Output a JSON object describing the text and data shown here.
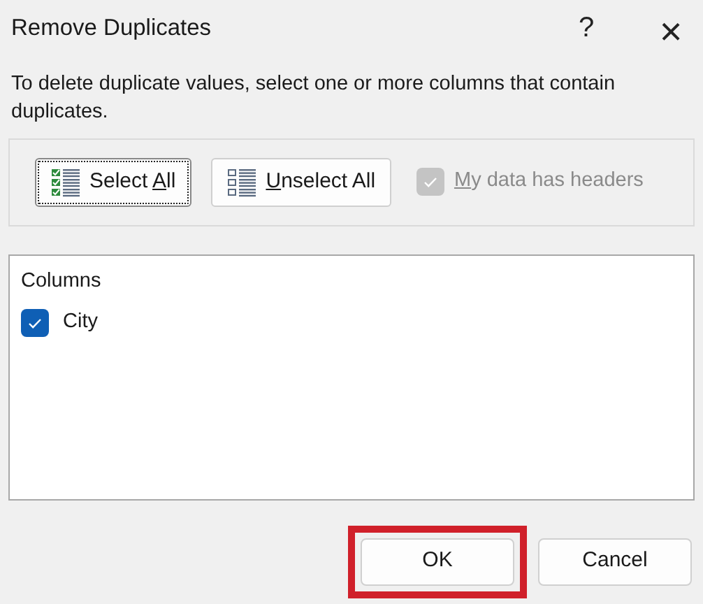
{
  "window": {
    "title": "Remove Duplicates",
    "help": "?",
    "close": "×"
  },
  "description": "To delete duplicate values, select one or more columns that contain duplicates.",
  "toolbar": {
    "buttons": [
      {
        "kind": "select",
        "before": "Select ",
        "key": "A",
        "after": "ll",
        "focused": true
      },
      {
        "kind": "unselect",
        "key": "U",
        "after": "nselect All",
        "focused": false
      }
    ],
    "headers_option": {
      "key": "M",
      "after": "y data has headers",
      "checked": true,
      "disabled": true
    }
  },
  "columns_list": {
    "heading": "Columns",
    "items": [
      {
        "label": "City",
        "checked": true
      }
    ]
  },
  "buttons": [
    {
      "label": "OK",
      "highlighted": true
    },
    {
      "label": "Cancel",
      "highlighted": false
    }
  ]
}
